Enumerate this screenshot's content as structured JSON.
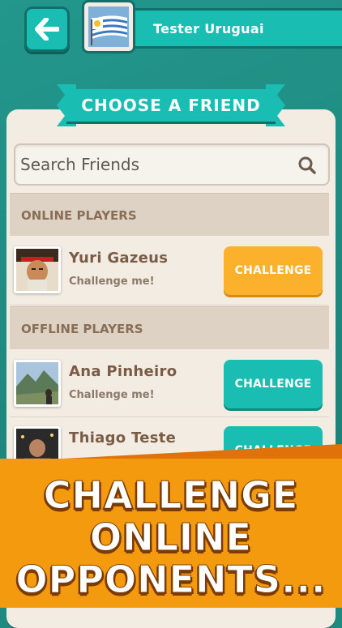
{
  "header": {
    "back_icon": "arrow-left-icon",
    "profile_name": "Tester Uruguai",
    "flag_icon": "uruguay-flag-icon"
  },
  "dialog": {
    "title": "CHOOSE A FRIEND",
    "search": {
      "placeholder": "Search Friends",
      "value": "",
      "icon": "search-icon"
    },
    "sections": [
      {
        "label": "ONLINE PLAYERS",
        "players": [
          {
            "name": "Yuri Gazeus",
            "status": "Challenge me!",
            "button": "CHALLENGE",
            "button_color": "#fbb12b"
          }
        ]
      },
      {
        "label": "OFFLINE PLAYERS",
        "players": [
          {
            "name": "Ana Pinheiro",
            "status": "Challenge me!",
            "button": "CHALLENGE",
            "button_color": "#19bdb1"
          },
          {
            "name": "Thiago Teste",
            "status": "",
            "button": "CHALLENGE",
            "button_color": "#19bdb1"
          }
        ]
      }
    ]
  },
  "banner": {
    "lines": [
      "CHALLENGE",
      "ONLINE",
      "OPPONENTS..."
    ]
  },
  "colors": {
    "teal": "#19bdb1",
    "orange": "#fbb12b",
    "banner_orange": "#f49a0f",
    "card_bg": "#f3ece2",
    "background": "#1f8a80"
  }
}
